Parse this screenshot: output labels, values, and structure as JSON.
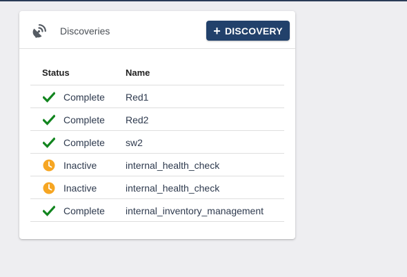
{
  "header": {
    "title": "Discoveries",
    "icon": "satellite-dish-icon",
    "add_button_label": "DISCOVERY",
    "add_button_icon": "plus-icon"
  },
  "table": {
    "columns": {
      "status": "Status",
      "name": "Name"
    },
    "rows": [
      {
        "status": "Complete",
        "status_icon": "check-icon",
        "name": "Red1"
      },
      {
        "status": "Complete",
        "status_icon": "check-icon",
        "name": "Red2"
      },
      {
        "status": "Complete",
        "status_icon": "check-icon",
        "name": "sw2"
      },
      {
        "status": "Inactive",
        "status_icon": "clock-icon",
        "name": "internal_health_check"
      },
      {
        "status": "Inactive",
        "status_icon": "clock-icon",
        "name": "internal_health_check"
      },
      {
        "status": "Complete",
        "status_icon": "check-icon",
        "name": "internal_inventory_management"
      }
    ]
  },
  "colors": {
    "primary": "#22416b",
    "complete": "#12851f",
    "inactive": "#f6a623",
    "topbar": "#2a3b57"
  }
}
